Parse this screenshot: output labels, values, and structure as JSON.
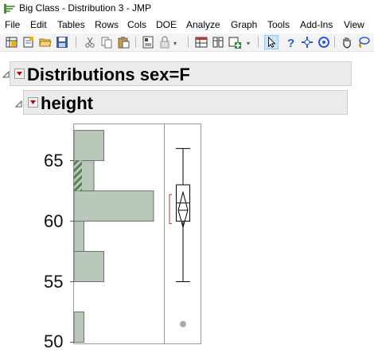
{
  "window": {
    "title": "Big Class - Distribution 3 - JMP",
    "icon": "jmp-app-icon"
  },
  "menu": [
    "File",
    "Edit",
    "Tables",
    "Rows",
    "Cols",
    "DOE",
    "Analyze",
    "Graph",
    "Tools",
    "Add-Ins",
    "View"
  ],
  "toolbar": {
    "icons": [
      "new-data-table-icon",
      "new-script-icon",
      "open-icon",
      "save-icon",
      "cut-icon",
      "copy-icon",
      "paste-icon",
      "journal-icon",
      "lock-icon",
      "data-table-list-icon",
      "column-icon",
      "add-icon",
      "arrow-tool-icon",
      "help-tool-icon",
      "crosshair-tool-icon",
      "selection-target-icon",
      "grabber-hand-icon",
      "lasso-icon"
    ]
  },
  "report": {
    "outline_title": "Distributions sex=F",
    "sub_outline_title": "height"
  },
  "chart_data": {
    "type": "histogram",
    "variable": "height",
    "orientation": "vertical",
    "yticks": [
      50,
      55,
      60,
      65
    ],
    "ylim": [
      49.9,
      68.0
    ],
    "bins": [
      {
        "low": 50,
        "high": 52.5,
        "count": 1
      },
      {
        "low": 52.5,
        "high": 55,
        "count": 0
      },
      {
        "low": 55,
        "high": 57.5,
        "count": 3
      },
      {
        "low": 57.5,
        "high": 60,
        "count": 1
      },
      {
        "low": 60,
        "high": 62.5,
        "count": 8
      },
      {
        "low": 62.5,
        "high": 65,
        "count": 2
      },
      {
        "low": 65,
        "high": 67.5,
        "count": 3
      }
    ],
    "highlighted_bin": {
      "low": 62.5,
      "high": 65,
      "count": 2
    },
    "max_count": 8,
    "boxplot": {
      "whisker_low": 55,
      "q1": 60,
      "median": 61.5,
      "q3": 63,
      "whisker_high": 66,
      "mean": 60.9,
      "mean_ci": [
        59.5,
        62.4
      ],
      "shortest_half": [
        59.8,
        62.2
      ],
      "outliers": [
        51.5
      ]
    },
    "colors": {
      "bar_fill": "#b9c9b9",
      "bar_stroke": "#6e6e6e",
      "highlight_fill": "#587f58",
      "shortest_half": "#c0392b",
      "outlier": "#a9a9a9"
    }
  }
}
